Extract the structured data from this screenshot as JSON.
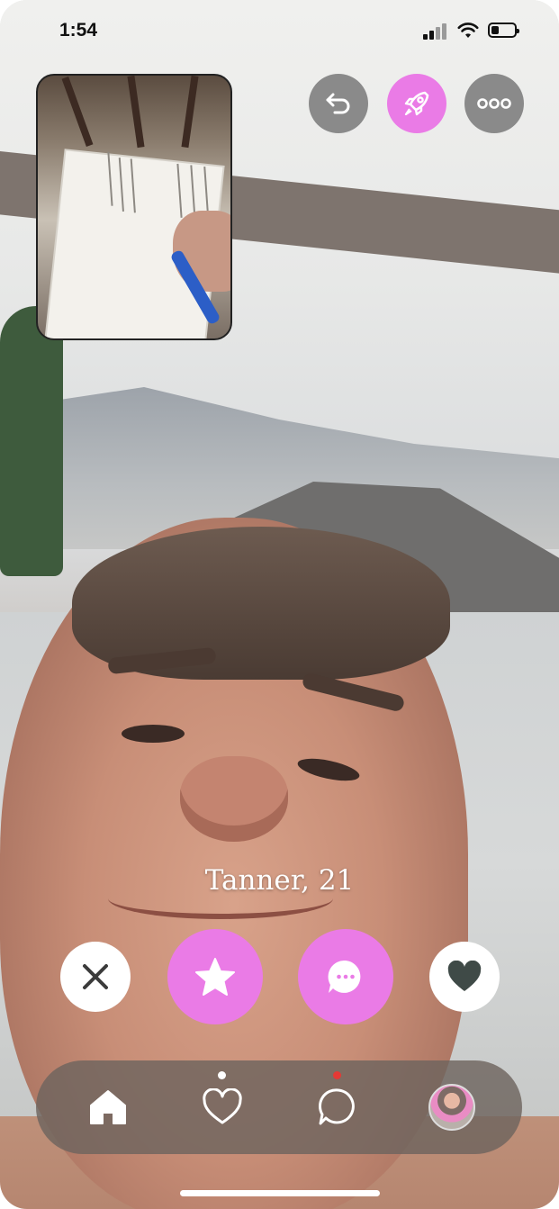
{
  "status_bar": {
    "time": "1:54"
  },
  "top_actions": {
    "undo_icon": "undo-arrow-icon",
    "boost_icon": "rocket-icon",
    "more_icon": "ellipsis-icon"
  },
  "profile": {
    "name_age": "Tanner, 21"
  },
  "actions": {
    "pass_icon": "close-x-icon",
    "super_like_icon": "star-icon",
    "message_icon": "chat-bubble-icon",
    "like_icon": "heart-icon"
  },
  "nav": {
    "home_icon": "home-icon",
    "likes_icon": "heart-outline-icon",
    "chat_icon": "chat-outline-icon",
    "profile_icon": "avatar"
  },
  "colors": {
    "accent": "#ea7be6",
    "neutral_button": "#8a8a8a",
    "nav_bg": "#6e645e",
    "notify_red": "#e53935",
    "dark_icon": "#3f4a47"
  }
}
